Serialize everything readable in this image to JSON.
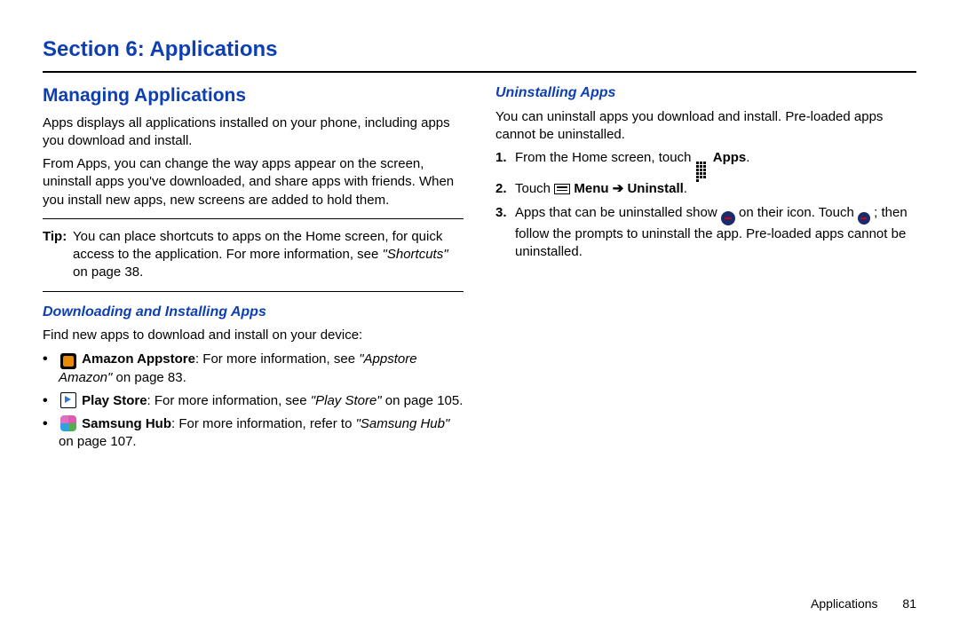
{
  "section_title": "Section 6: Applications",
  "left": {
    "h2": "Managing Applications",
    "p1": "Apps displays all applications installed on your phone, including apps you download and install.",
    "p2": "From Apps, you can change the way apps appear on the screen, uninstall apps you've downloaded, and share apps with friends. When you install new apps, new screens are added to hold them.",
    "tip_label": "Tip:",
    "tip_body_a": "You can place shortcuts to apps on the Home screen, for quick access to the application. For more information, see ",
    "tip_ref": "\"Shortcuts\"",
    "tip_body_b": " on page 38.",
    "h3": "Downloading and Installing Apps",
    "p3": "Find new apps to download and install on your device:",
    "li1_name": "Amazon Appstore",
    "li1_a": ": For more information, see ",
    "li1_ref": "\"Appstore Amazon\"",
    "li1_b": " on page 83.",
    "li2_name": "Play Store",
    "li2_a": ": For more information, see ",
    "li2_ref": "\"Play Store\"",
    "li2_b": " on page 105.",
    "li3_name": "Samsung Hub",
    "li3_a": ": For more information, refer to ",
    "li3_ref": "\"Samsung Hub\"",
    "li3_b": "  on page 107."
  },
  "right": {
    "h3": "Uninstalling Apps",
    "p1": "You can uninstall apps you download and install. Pre-loaded apps cannot be uninstalled.",
    "s1_a": "From the Home screen, touch ",
    "s1_b": "Apps",
    "s1_c": ".",
    "s2_a": "Touch ",
    "s2_b": "Menu",
    "s2_arrow": " ➔ ",
    "s2_c": "Uninstall",
    "s2_d": ".",
    "s3_a": "Apps that can be uninstalled show ",
    "s3_b": " on their icon. Touch ",
    "s3_c": "; then follow the prompts to uninstall the app. Pre-loaded apps cannot be uninstalled.",
    "num1": "1.",
    "num2": "2.",
    "num3": "3."
  },
  "footer": {
    "label": "Applications",
    "page": "81"
  }
}
